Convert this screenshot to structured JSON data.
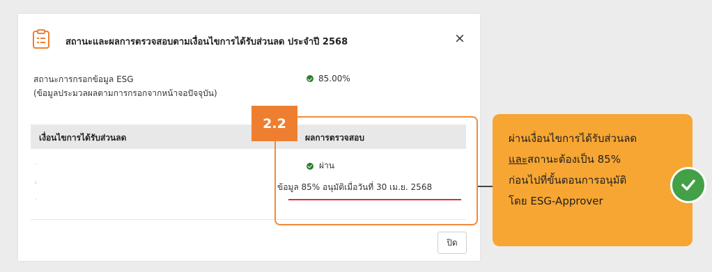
{
  "dialog": {
    "title": "สถานะและผลการตรวจสอบตามเงื่อนไขการได้รับส่วนลด ประจำปี 2568",
    "close_glyph": "×",
    "status_label_line1": "สถานะการกรอกข้อมูล ESG",
    "status_label_line2": "(ข้อมูลประมวลผลตามการกรอกจากหน้าจอปัจจุบัน)",
    "status_value": "85.00%",
    "table": {
      "col_condition": "เงื่อนไขการได้รับส่วนลด",
      "col_result": "ผลการตรวจสอบ"
    },
    "result_status": "ผ่าน",
    "result_detail": "ข้อมูล 85% อนุมัติเมื่อวันที่ 30 เม.ย. 2568",
    "close_button": "ปิด"
  },
  "annotation": {
    "step": "2.2",
    "callout_line1": "ผ่านเงื่อนไขการได้รับส่วนลด",
    "callout_line2_underlined": "และ",
    "callout_line2_rest": "สถานะต้องเป็น 85%",
    "callout_line3": "ก่อนไปที่ขั้นตอนการอนุมัติ",
    "callout_line4": "โดย ESG-Approver"
  },
  "colors": {
    "accent_orange": "#ef7f30",
    "callout_bg": "#f7a633",
    "success_green": "#2e7d32",
    "underline_red": "#d32f2f"
  },
  "icons": [
    "clipboard-icon",
    "close-icon",
    "check-circle-icon",
    "check-icon"
  ]
}
